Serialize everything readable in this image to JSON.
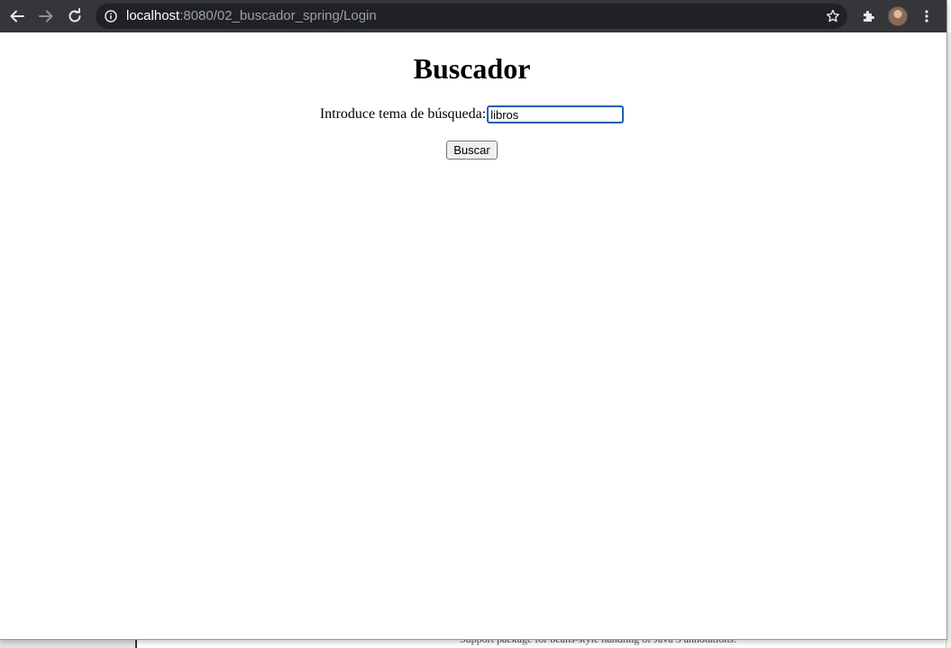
{
  "browser": {
    "url_host": "localhost",
    "url_path": ":8080/02_buscador_spring/Login"
  },
  "page": {
    "title": "Buscador",
    "search_label": "Introduce tema de búsqueda:",
    "search_value": "libros",
    "submit_label": "Buscar"
  },
  "background": {
    "doc_text": "Support package for beans-style handling of Java 5 annotations."
  },
  "colors": {
    "toolbar": "#35363a",
    "omnibox": "#202124",
    "input_focus": "#1a5fb4"
  }
}
